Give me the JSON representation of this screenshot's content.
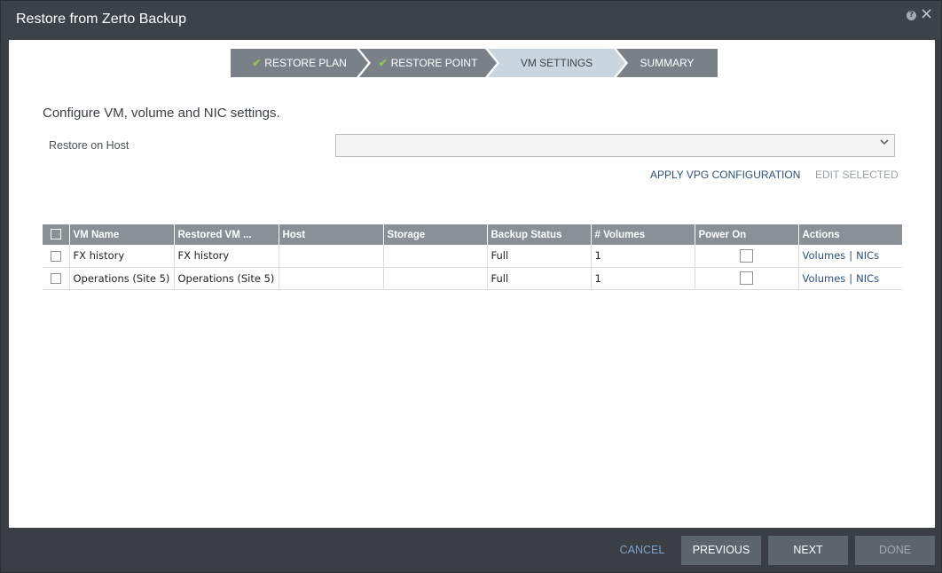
{
  "window": {
    "title": "Restore from Zerto Backup",
    "help_glyph": "?",
    "close_glyph": "×"
  },
  "wizard": {
    "steps": [
      {
        "label": "RESTORE PLAN",
        "done": true
      },
      {
        "label": "RESTORE POINT",
        "done": true
      },
      {
        "label": "VM SETTINGS",
        "done": false,
        "active": true
      },
      {
        "label": "SUMMARY",
        "done": false
      }
    ],
    "check_glyph": "✔"
  },
  "main": {
    "heading": "Configure VM, volume and NIC settings.",
    "host_label": "Restore on Host",
    "host_value": "",
    "apply_vpg": "APPLY VPG CONFIGURATION",
    "edit_selected": "EDIT SELECTED"
  },
  "table": {
    "columns": [
      "VM Name",
      "Restored VM ...",
      "Host",
      "Storage",
      "Backup Status",
      "# Volumes",
      "Power On",
      "Actions"
    ],
    "rows": [
      {
        "vm_name": "FX history",
        "restored": "FX history",
        "host": "",
        "storage": "",
        "status": "Full",
        "volumes": "1",
        "power_on": false,
        "action_volumes": "Volumes",
        "action_sep": "|",
        "action_nics": "NICs"
      },
      {
        "vm_name": "Operations (Site 5)",
        "restored": "Operations (Site 5)",
        "host": "",
        "storage": "",
        "status": "Full",
        "volumes": "1",
        "power_on": false,
        "action_volumes": "Volumes",
        "action_sep": "|",
        "action_nics": "NICs"
      }
    ]
  },
  "footer": {
    "cancel": "CANCEL",
    "previous": "PREVIOUS",
    "next": "NEXT",
    "done": "DONE"
  },
  "colors": {
    "titlebar": "#3d4249",
    "header": "#8b9097",
    "button": "#5e646c",
    "link": "#2d4f7f",
    "active_step": "#c9d6e0",
    "check": "#8fc84a"
  }
}
